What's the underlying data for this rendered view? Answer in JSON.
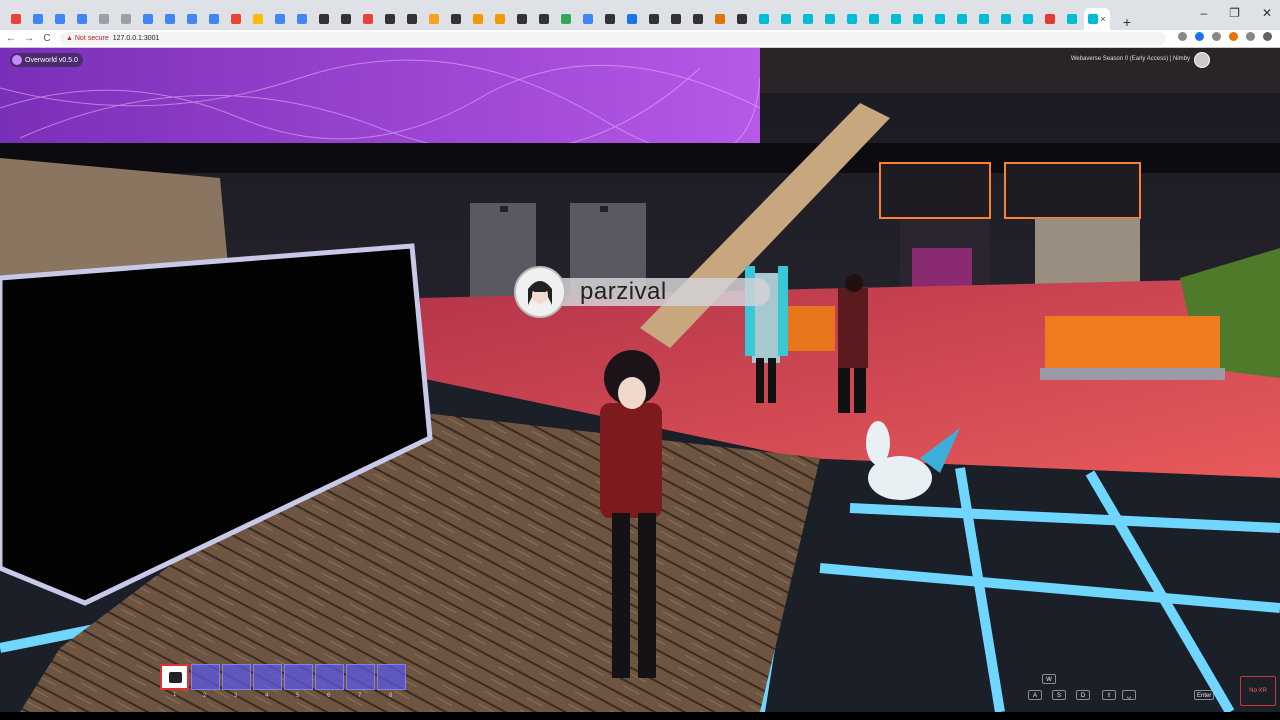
{
  "browser": {
    "tab_colors": [
      "#ea4335",
      "#4285f4",
      "#4285f4",
      "#4285f4",
      "#9aa0a6",
      "#9aa0a6",
      "#4285f4",
      "#4285f4",
      "#4285f4",
      "#4285f4",
      "#ea4335",
      "#fbbc04",
      "#4285f4",
      "#4285f4",
      "#333333",
      "#333333",
      "#ea4335",
      "#333333",
      "#333333",
      "#f6a21d",
      "#333333",
      "#f29900",
      "#f29900",
      "#333333",
      "#333333",
      "#34a853",
      "#4285f4",
      "#333333",
      "#1a73e8",
      "#333333",
      "#333333",
      "#333333",
      "#e37400",
      "#333333",
      "#00bcd4",
      "#00bcd4",
      "#00bcd4",
      "#00bcd4",
      "#00bcd4",
      "#00bcd4",
      "#00bcd4",
      "#00bcd4",
      "#00bcd4",
      "#00bcd4",
      "#00bcd4",
      "#00bcd4",
      "#00bcd4",
      "#e53935",
      "#00bcd4",
      "#00bcd4"
    ],
    "active_tab_close": "×",
    "new_tab": "+",
    "window_controls": [
      "–",
      "❐",
      "✕"
    ],
    "back": "←",
    "forward": "→",
    "reload": "C",
    "security_warning": "▲ Not secure",
    "url": "127.0.0.1:3001",
    "toolbar_icon_colors": [
      "#888888",
      "#1a73e8",
      "#888888",
      "#e37400",
      "#888888",
      "#5f6368"
    ]
  },
  "game": {
    "version": "Overworld v0.5.0",
    "season": "Webaverse Season 0 (Early Access) | Nimby",
    "player_name": "parzival",
    "hotbar": {
      "slots": [
        {
          "number": "1",
          "active": true
        },
        {
          "number": "2",
          "active": false
        },
        {
          "number": "3",
          "active": false
        },
        {
          "number": "4",
          "active": false
        },
        {
          "number": "5",
          "active": false
        },
        {
          "number": "6",
          "active": false
        },
        {
          "number": "7",
          "active": false
        },
        {
          "number": "8",
          "active": false
        }
      ]
    },
    "keys": {
      "w": "W",
      "a": "A",
      "s": "S",
      "d": "D",
      "shift": "⇧",
      "space": "␣",
      "enter": "Enter",
      "no_xr": "No XR"
    }
  }
}
